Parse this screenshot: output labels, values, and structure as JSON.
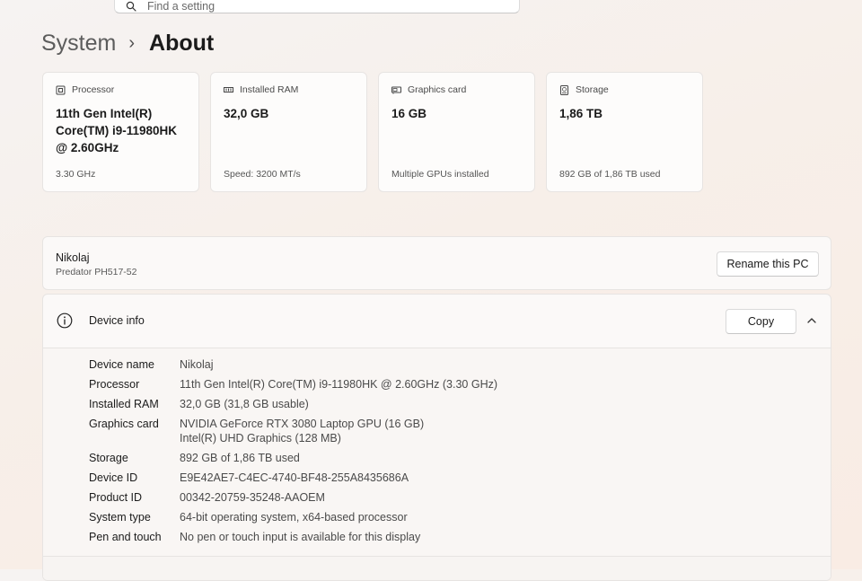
{
  "search": {
    "placeholder": "Find a setting"
  },
  "breadcrumb": {
    "parent": "System",
    "separator": "›",
    "current": "About"
  },
  "spec_cards": [
    {
      "icon": "processor-icon",
      "label": "Processor",
      "value": "11th Gen Intel(R) Core(TM) i9-11980HK @ 2.60GHz",
      "sub": "3.30 GHz"
    },
    {
      "icon": "ram-icon",
      "label": "Installed RAM",
      "value": "32,0 GB",
      "sub": "Speed: 3200 MT/s"
    },
    {
      "icon": "graphics-card-icon",
      "label": "Graphics card",
      "value": "16 GB",
      "sub": "Multiple GPUs installed"
    },
    {
      "icon": "storage-icon",
      "label": "Storage",
      "value": "1,86 TB",
      "sub": "892 GB of 1,86 TB used"
    }
  ],
  "pc": {
    "name": "Nikolaj",
    "model": "Predator PH517-52",
    "rename_label": "Rename this PC"
  },
  "device_info": {
    "title": "Device info",
    "copy_label": "Copy",
    "expanded": true,
    "rows": [
      {
        "label": "Device name",
        "value": "Nikolaj"
      },
      {
        "label": "Processor",
        "value": "11th Gen Intel(R) Core(TM) i9-11980HK @ 2.60GHz (3.30 GHz)"
      },
      {
        "label": "Installed RAM",
        "value": "32,0 GB (31,8 GB usable)"
      },
      {
        "label": "Graphics card",
        "value": "NVIDIA GeForce RTX 3080 Laptop GPU (16 GB)",
        "value2": "Intel(R) UHD Graphics (128 MB)"
      },
      {
        "label": "Storage",
        "value": "892 GB of 1,86 TB used"
      },
      {
        "label": "Device ID",
        "value": "E9E42AE7-C4EC-4740-BF48-255A8435686A"
      },
      {
        "label": "Product ID",
        "value": "00342-20759-35248-AAOEM"
      },
      {
        "label": "System type",
        "value": "64-bit operating system, x64-based processor"
      },
      {
        "label": "Pen and touch",
        "value": "No pen or touch input is available for this display"
      }
    ]
  }
}
